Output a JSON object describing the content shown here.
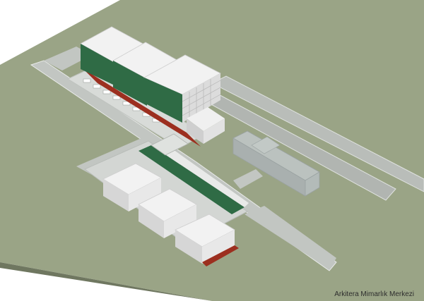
{
  "credit": {
    "text": "Arkitera Mimarlık Merkezi"
  },
  "colors": {
    "background": "#ffffff",
    "terrain_top": "#9aa486",
    "terrain_side": "#6f7760",
    "road": "#bfc2bf",
    "sidewalk": "#e6e8e6",
    "facade_light": "#eeeeee",
    "facade_shade": "#c9c9c9",
    "roof": "#f4f4f4",
    "glass_green": "#2f6b45",
    "accent_red": "#9c2f1f",
    "ghost_building": "#b9bfc6"
  }
}
